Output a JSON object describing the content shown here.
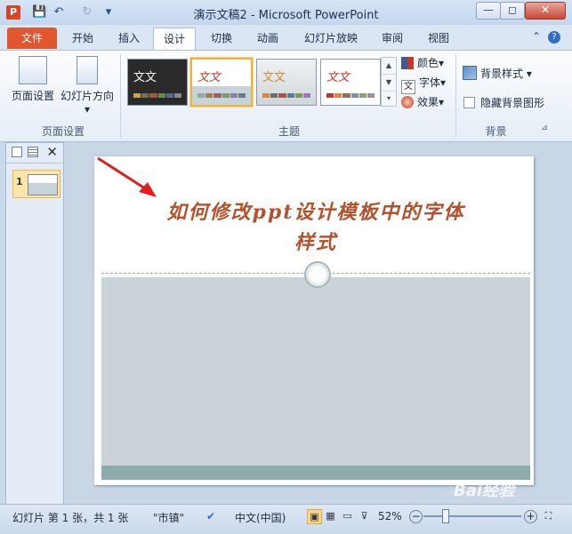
{
  "titlebar": {
    "app_icon": "P",
    "title": "演示文稿2  -  Microsoft PowerPoint",
    "save_icon": "💾",
    "undo_icon": "↶",
    "redo_icon": "↻",
    "customize_icon": "▾",
    "minimize": "—",
    "restore": "◻",
    "close": "✕"
  },
  "tabs": [
    "文件",
    "开始",
    "插入",
    "设计",
    "切换",
    "动画",
    "幻灯片放映",
    "审阅",
    "视图"
  ],
  "tab_active": "设计",
  "ribbon_right": {
    "minimize_ribbon": "⌃",
    "help": "?"
  },
  "page_setup": {
    "page_setup_label": "页面设置",
    "orientation_label": "幻灯片方向",
    "orientation_caret": "▾",
    "group_label": "页面设置"
  },
  "themes": {
    "items": [
      {
        "title": "文文",
        "bg": "#2a2a2a",
        "text": "#ffffff",
        "swatches": [
          "#c8a44a",
          "#7c6f5a",
          "#a05a3c",
          "#6b8a4e",
          "#4f6f8c",
          "#888888"
        ]
      },
      {
        "title": "文文",
        "bg": "#ffffff",
        "text": "#c0392b",
        "swatches": [
          "#8caba9",
          "#a67c52",
          "#a05f5f",
          "#7e9a6a",
          "#8a7fa6",
          "#6a7b88"
        ]
      },
      {
        "title": "文文",
        "bg": "#e8ecee",
        "text": "#d4883a",
        "swatches": [
          "#d4883a",
          "#6b6b6b",
          "#a0574a",
          "#5a7a9a",
          "#7a9a5a",
          "#9a7ab0"
        ]
      },
      {
        "title": "文文",
        "bg": "#ffffff",
        "text": "#c0392b",
        "swatches": [
          "#c0392b",
          "#d68a4a",
          "#a06a5a",
          "#7a8fa0",
          "#8aa07a",
          "#a08aa0"
        ]
      }
    ],
    "group_label": "主题",
    "scroll_up": "▲",
    "scroll_down": "▼",
    "more": "▾",
    "colors_label": "颜色",
    "fonts_label": "字体",
    "effects_label": "效果",
    "caret": "▾"
  },
  "background": {
    "bg_styles_label": "背景样式",
    "bg_styles_caret": "▾",
    "hide_bg_label": "隐藏背景图形",
    "group_label": "背景",
    "launcher_icon": "⊿"
  },
  "panel": {
    "close_icon": "✕",
    "slide_number": "1"
  },
  "slide": {
    "title_line1": "如何修改ppt设计模板中的字体",
    "title_line2": "样式"
  },
  "status": {
    "slide_info": "幻灯片 第 1 张，共 1 张",
    "theme_name": "\"市镇\"",
    "language": "中文(中国)",
    "zoom": "52%",
    "zoom_out": "−",
    "zoom_in": "+",
    "watermark": "Bai经验"
  }
}
